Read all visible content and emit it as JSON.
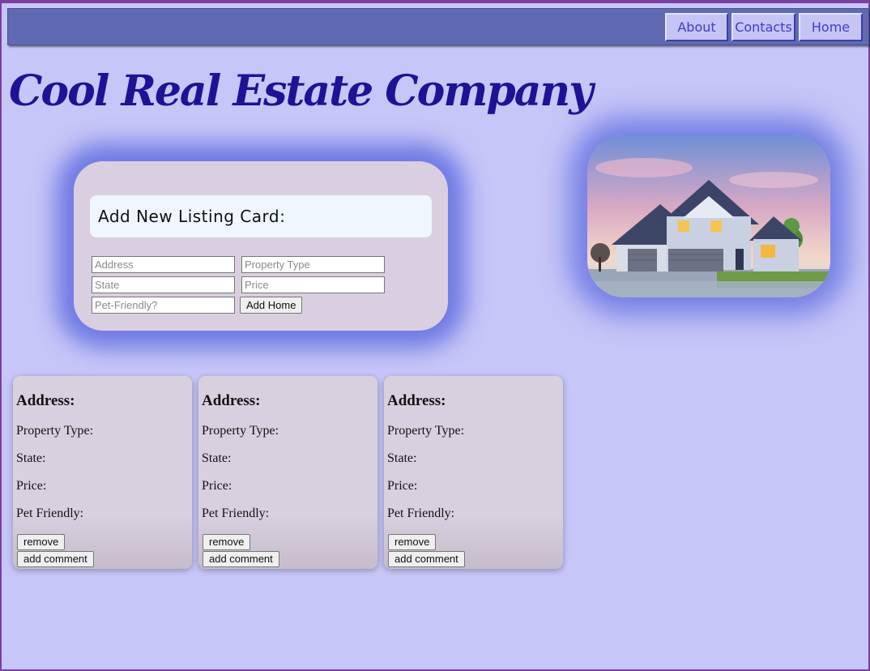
{
  "nav": {
    "items": [
      {
        "label": "About"
      },
      {
        "label": "Contacts"
      },
      {
        "label": "Home"
      }
    ]
  },
  "header": {
    "title": "Cool Real Estate Company"
  },
  "form": {
    "heading": "Add New Listing Card:",
    "address_placeholder": "Address",
    "property_type_placeholder": "Property Type",
    "state_placeholder": "State",
    "price_placeholder": "Price",
    "pet_friendly_placeholder": "Pet-Friendly?",
    "submit_label": "Add Home"
  },
  "hero_image": {
    "icon": "house-photo"
  },
  "listings": [
    {
      "address_label": "Address:",
      "property_type_label": "Property Type:",
      "state_label": "State:",
      "price_label": "Price:",
      "pet_friendly_label": "Pet Friendly:",
      "remove_label": "remove",
      "comment_label": "add comment"
    },
    {
      "address_label": "Address:",
      "property_type_label": "Property Type:",
      "state_label": "State:",
      "price_label": "Price:",
      "pet_friendly_label": "Pet Friendly:",
      "remove_label": "remove",
      "comment_label": "add comment"
    },
    {
      "address_label": "Address:",
      "property_type_label": "Property Type:",
      "state_label": "State:",
      "price_label": "Price:",
      "pet_friendly_label": "Pet Friendly:",
      "remove_label": "remove",
      "comment_label": "add comment"
    }
  ],
  "colors": {
    "background": "#c7c6f8",
    "navbar": "#5f6ab3",
    "title": "#1d1396",
    "card": "#dacfe0",
    "glow": "#505fdc"
  }
}
